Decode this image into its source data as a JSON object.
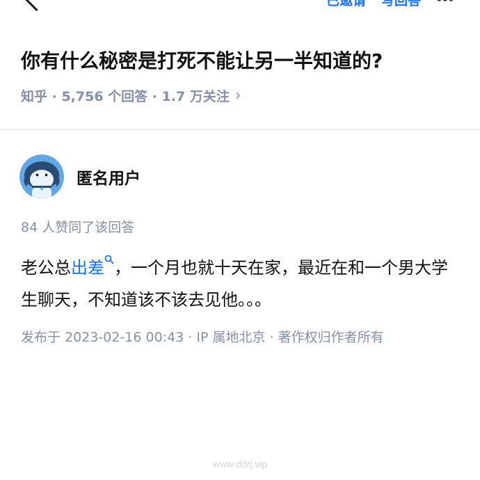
{
  "topbar": {
    "left_action": "已邀请",
    "right_action": "写回答",
    "more_label": "⋯"
  },
  "question": {
    "title": "你有什么秘密是打死不能让另一半知道的?",
    "meta": "知乎 · 5,756 个回答 · 1.7 万关注",
    "meta_chevron": "›"
  },
  "author": {
    "name": "匿名用户"
  },
  "answer": {
    "votes": "84 人赞同了该回答",
    "text_before": "老公总",
    "link_text": "出差",
    "text_after": "，一个月也就十天在家，最近在和一个男大学生聊天，不知道该不该去见他。。。",
    "published": "发布于 2023-02-16 00:43 · IP 属地北京 · 著作权归作者所有"
  },
  "watermark": "www.ddrj.vip",
  "icons": {
    "back": "back-chevron-icon",
    "search": "search-icon",
    "avatar": "anonymous-avatar-icon"
  },
  "colors": {
    "link": "#1772f6",
    "meta": "#8590a6",
    "avatar_bg": "#5fa9e6"
  }
}
